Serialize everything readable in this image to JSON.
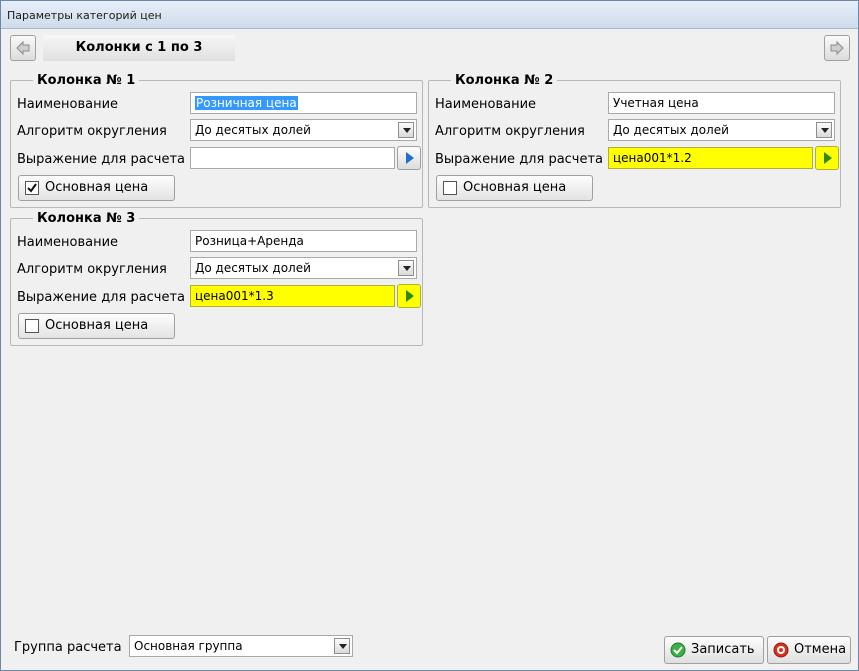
{
  "window": {
    "title": "Параметры категорий цен"
  },
  "nav": {
    "header": "Колонки с 1 по 3"
  },
  "labels": {
    "name": "Наименование",
    "rounding": "Алгоритм округления",
    "expression": "Выражение для расчета",
    "main_price": "Основная цена"
  },
  "columns": [
    {
      "legend": "Колонка № 1",
      "name": "Розничная цена",
      "rounding": "До десятых долей",
      "expression": "",
      "main_price": true
    },
    {
      "legend": "Колонка № 2",
      "name": "Учетная цена",
      "rounding": "До десятых долей",
      "expression": "цена001*1.2",
      "main_price": false
    },
    {
      "legend": "Колонка № 3",
      "name": "Розница+Аренда",
      "rounding": "До десятых долей",
      "expression": "цена001*1.3",
      "main_price": false
    }
  ],
  "footer": {
    "group_label": "Группа расчета",
    "group_value": "Основная группа",
    "save_label": "Записать",
    "cancel_label": "Отмена"
  },
  "colors": {
    "highlight": "#ffff00",
    "selection": "#3399ff",
    "save_icon": "#3cb043",
    "cancel_icon": "#d9321c",
    "go_arrow": "#1e6fd0",
    "go_arrow_yellow": "#2e8b00"
  },
  "icons": {
    "prev": "arrow-left-icon",
    "next": "arrow-right-icon",
    "go": "play-arrow-icon",
    "dropdown": "chevron-down-icon",
    "save": "check-circle-icon",
    "cancel": "stop-circle-icon"
  }
}
